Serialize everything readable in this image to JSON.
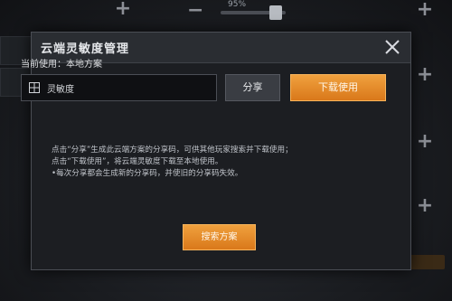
{
  "background": {
    "slider_percent_label": "95%",
    "slider_level": 0.95
  },
  "dialog": {
    "title": "云端灵敏度管理",
    "current_usage": "当前使用：本地方案",
    "scheme_name": "灵敏度",
    "share_label": "分享",
    "download_label": "下载使用",
    "description_lines": [
      "点击“分享”生成此云端方案的分享码，可供其他玩家搜索并下载使用；",
      "点击“下载使用”，将云端灵敏度下载至本地使用。",
      "•每次分享都会生成新的分享码，并使旧的分享码失效。"
    ],
    "search_label": "搜索方案"
  },
  "colors": {
    "accent_orange": "#e8892a",
    "dialog_bg": "#1c1e22",
    "header_bg": "#2a2d32"
  },
  "icons": {
    "close": "close-icon",
    "document": "document-icon",
    "plus": "plus-icon",
    "minus": "minus-icon"
  }
}
